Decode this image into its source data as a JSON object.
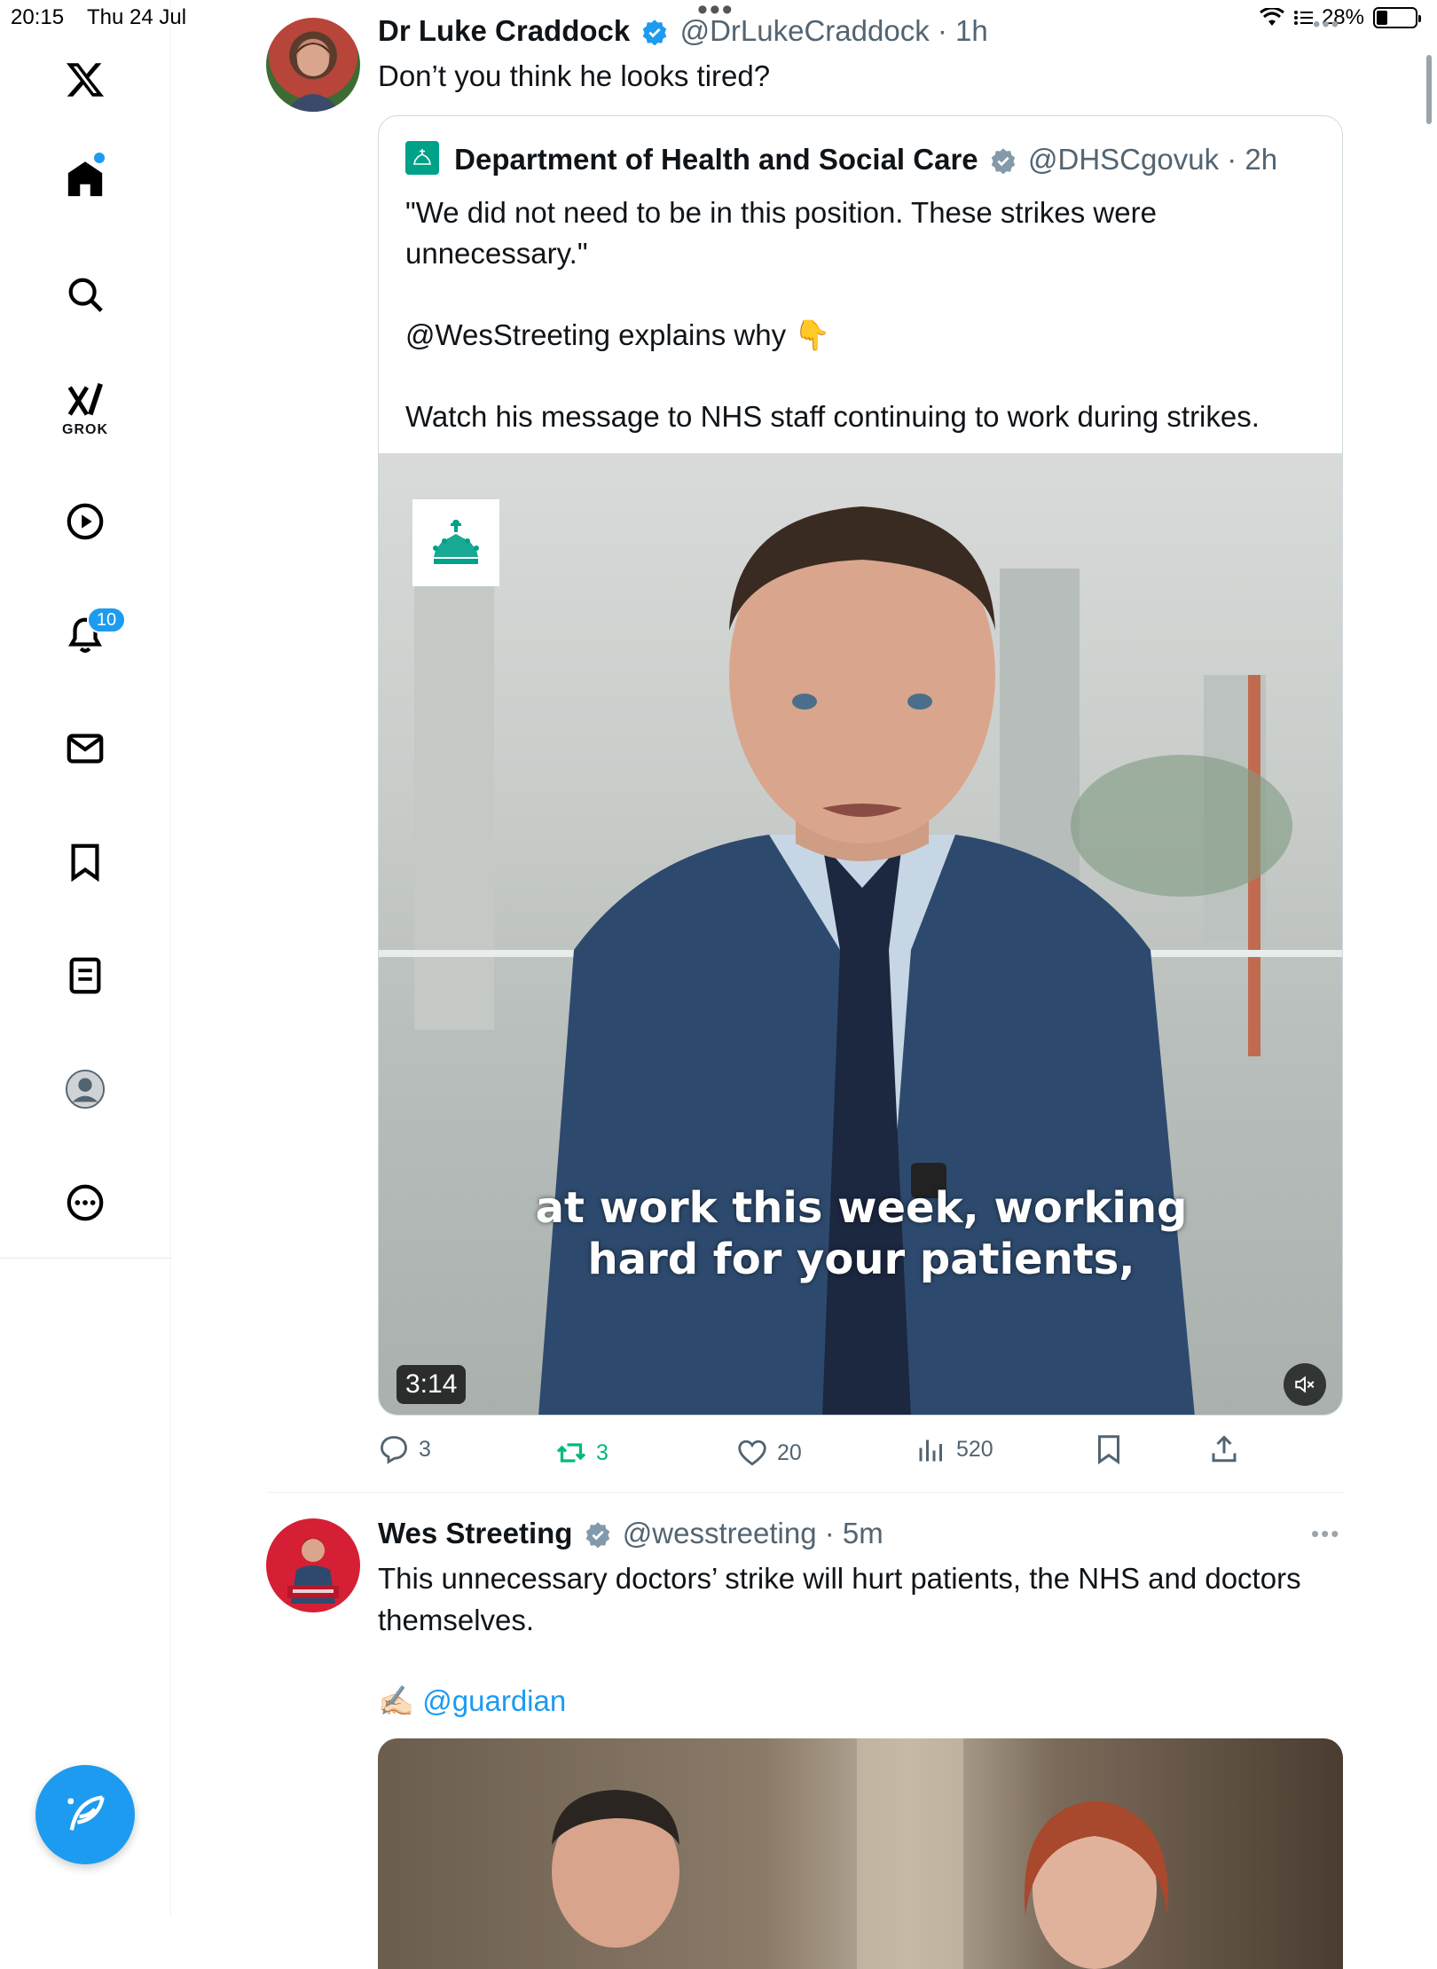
{
  "status_bar": {
    "time": "20:15",
    "date": "Thu 24 Jul",
    "battery": "28%"
  },
  "sidebar": {
    "items": [
      {
        "name": "x-logo-icon",
        "label": ""
      },
      {
        "name": "home-icon",
        "label": ""
      },
      {
        "name": "search-icon",
        "label": ""
      },
      {
        "name": "grok-icon",
        "label": "GROK"
      },
      {
        "name": "video-icon",
        "label": ""
      },
      {
        "name": "notifications-icon",
        "label": ""
      },
      {
        "name": "messages-icon",
        "label": ""
      },
      {
        "name": "bookmarks-icon",
        "label": ""
      },
      {
        "name": "lists-icon",
        "label": ""
      },
      {
        "name": "profile-icon",
        "label": ""
      },
      {
        "name": "more-icon",
        "label": ""
      }
    ],
    "notifications_badge": "10",
    "accent_color": "#1d9bf0"
  },
  "tweet1": {
    "name": "Dr Luke Craddock",
    "handle": "@DrLukeCraddock",
    "time": "1h",
    "text": "Don’t you think he looks tired?",
    "quote": {
      "name": "Department of Health and Social Care",
      "handle": "@DHSCgovuk",
      "time": "2h",
      "paragraphs": [
        "\"We did not need to be in this position. These strikes were unnecessary.\"",
        "@WesStreeting explains why 👇",
        "Watch his message to NHS staff continuing to work during strikes."
      ],
      "video": {
        "caption_line1": "at work this week, working",
        "caption_line2": "hard for your patients,",
        "duration": "3:14"
      }
    },
    "actions": {
      "replies": "3",
      "reposts": "3",
      "likes": "20",
      "views": "520"
    },
    "repost_color": "#00ba7c"
  },
  "tweet2": {
    "name": "Wes Streeting",
    "handle": "@wesstreeting",
    "time": "5m",
    "text": "This unnecessary doctors’ strike will hurt patients, the NHS and doctors themselves.",
    "credit_emoji": "✍🏻",
    "credit_link": "@guardian"
  }
}
